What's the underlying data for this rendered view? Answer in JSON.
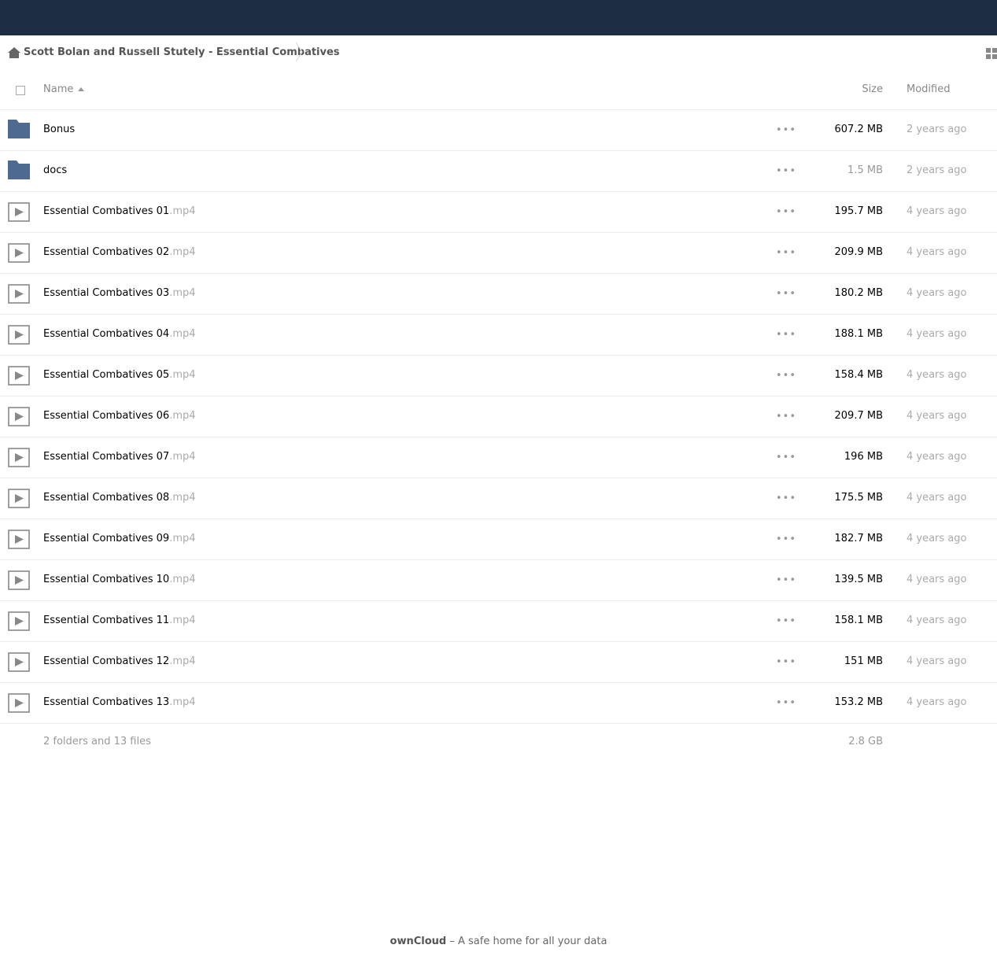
{
  "breadcrumb": {
    "folder": "Scott Bolan and Russell Stutely - Essential Combatives"
  },
  "columns": {
    "name": "Name",
    "size": "Size",
    "modified": "Modified"
  },
  "actions_label": "•••",
  "files": [
    {
      "type": "folder",
      "name": "Bonus",
      "ext": "",
      "size": "607.2 MB",
      "modified": "2 years ago",
      "light": false
    },
    {
      "type": "folder",
      "name": "docs",
      "ext": "",
      "size": "1.5 MB",
      "modified": "2 years ago",
      "light": true
    },
    {
      "type": "video",
      "name": "Essential Combatives 01",
      "ext": ".mp4",
      "size": "195.7 MB",
      "modified": "4 years ago",
      "light": false
    },
    {
      "type": "video",
      "name": "Essential Combatives 02",
      "ext": ".mp4",
      "size": "209.9 MB",
      "modified": "4 years ago",
      "light": false
    },
    {
      "type": "video",
      "name": "Essential Combatives 03",
      "ext": ".mp4",
      "size": "180.2 MB",
      "modified": "4 years ago",
      "light": false
    },
    {
      "type": "video",
      "name": "Essential Combatives 04",
      "ext": ".mp4",
      "size": "188.1 MB",
      "modified": "4 years ago",
      "light": false
    },
    {
      "type": "video",
      "name": "Essential Combatives 05",
      "ext": ".mp4",
      "size": "158.4 MB",
      "modified": "4 years ago",
      "light": false
    },
    {
      "type": "video",
      "name": "Essential Combatives 06",
      "ext": ".mp4",
      "size": "209.7 MB",
      "modified": "4 years ago",
      "light": false
    },
    {
      "type": "video",
      "name": "Essential Combatives 07",
      "ext": ".mp4",
      "size": "196 MB",
      "modified": "4 years ago",
      "light": false
    },
    {
      "type": "video",
      "name": "Essential Combatives 08",
      "ext": ".mp4",
      "size": "175.5 MB",
      "modified": "4 years ago",
      "light": false
    },
    {
      "type": "video",
      "name": "Essential Combatives 09",
      "ext": ".mp4",
      "size": "182.7 MB",
      "modified": "4 years ago",
      "light": false
    },
    {
      "type": "video",
      "name": "Essential Combatives 10",
      "ext": ".mp4",
      "size": "139.5 MB",
      "modified": "4 years ago",
      "light": false
    },
    {
      "type": "video",
      "name": "Essential Combatives 11",
      "ext": ".mp4",
      "size": "158.1 MB",
      "modified": "4 years ago",
      "light": false
    },
    {
      "type": "video",
      "name": "Essential Combatives 12",
      "ext": ".mp4",
      "size": "151 MB",
      "modified": "4 years ago",
      "light": false
    },
    {
      "type": "video",
      "name": "Essential Combatives 13",
      "ext": ".mp4",
      "size": "153.2 MB",
      "modified": "4 years ago",
      "light": false
    }
  ],
  "summary": {
    "count": "2 folders and 13 files",
    "total": "2.8 GB"
  },
  "footer": {
    "brand": "ownCloud",
    "tagline": " – A safe home for all your data"
  },
  "colors": {
    "topbar": "#1d2d44",
    "folder": "#4f6a91",
    "video_icon": "#888888"
  }
}
